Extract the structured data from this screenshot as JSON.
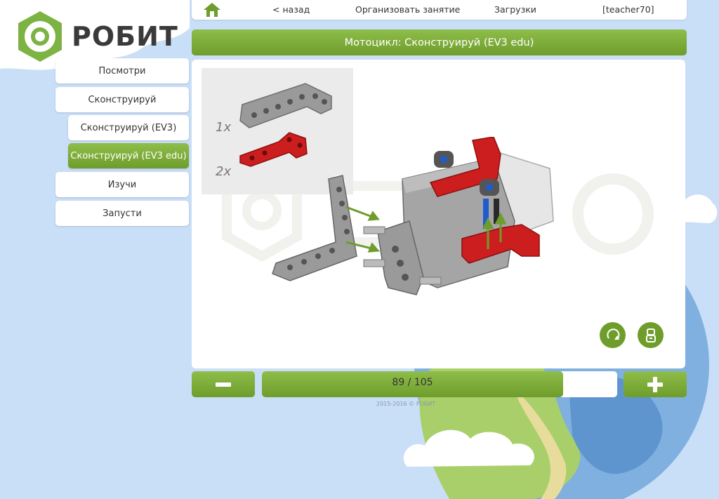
{
  "brand": {
    "name": "РОБИТ"
  },
  "topbar": {
    "back": "< назад",
    "organize": "Организовать занятие",
    "downloads": "Загрузки",
    "user": "[teacher70]"
  },
  "title": "Мотоцикл: Сконструируй (EV3 edu)",
  "sidebar": {
    "items": [
      {
        "label": "Посмотри",
        "active": false
      },
      {
        "label": "Сконструируй",
        "active": false
      },
      {
        "label": "Сконструируй (EV3)",
        "active": false
      },
      {
        "label": "Сконструируй (EV3 edu)",
        "active": true
      },
      {
        "label": "Изучи",
        "active": false
      },
      {
        "label": "Запусти",
        "active": false
      }
    ]
  },
  "parts": [
    {
      "qty": "1x",
      "color": "#9a9a9a"
    },
    {
      "qty": "2x",
      "color": "#cc1e1e"
    }
  ],
  "pager": {
    "current": 89,
    "total": 105,
    "label": "89 / 105"
  },
  "footer": "2015-2016 © РОБИТ",
  "icons": {
    "home": "home-icon",
    "minus": "minus-icon",
    "plus": "plus-icon",
    "rotate": "rotate-icon",
    "robot": "robot-icon",
    "toolbox": "toolbox-icon"
  },
  "colors": {
    "accent": "#7aa83a",
    "background": "#c9def7",
    "part_red": "#cc1e1e",
    "part_gray": "#9a9a9a"
  }
}
